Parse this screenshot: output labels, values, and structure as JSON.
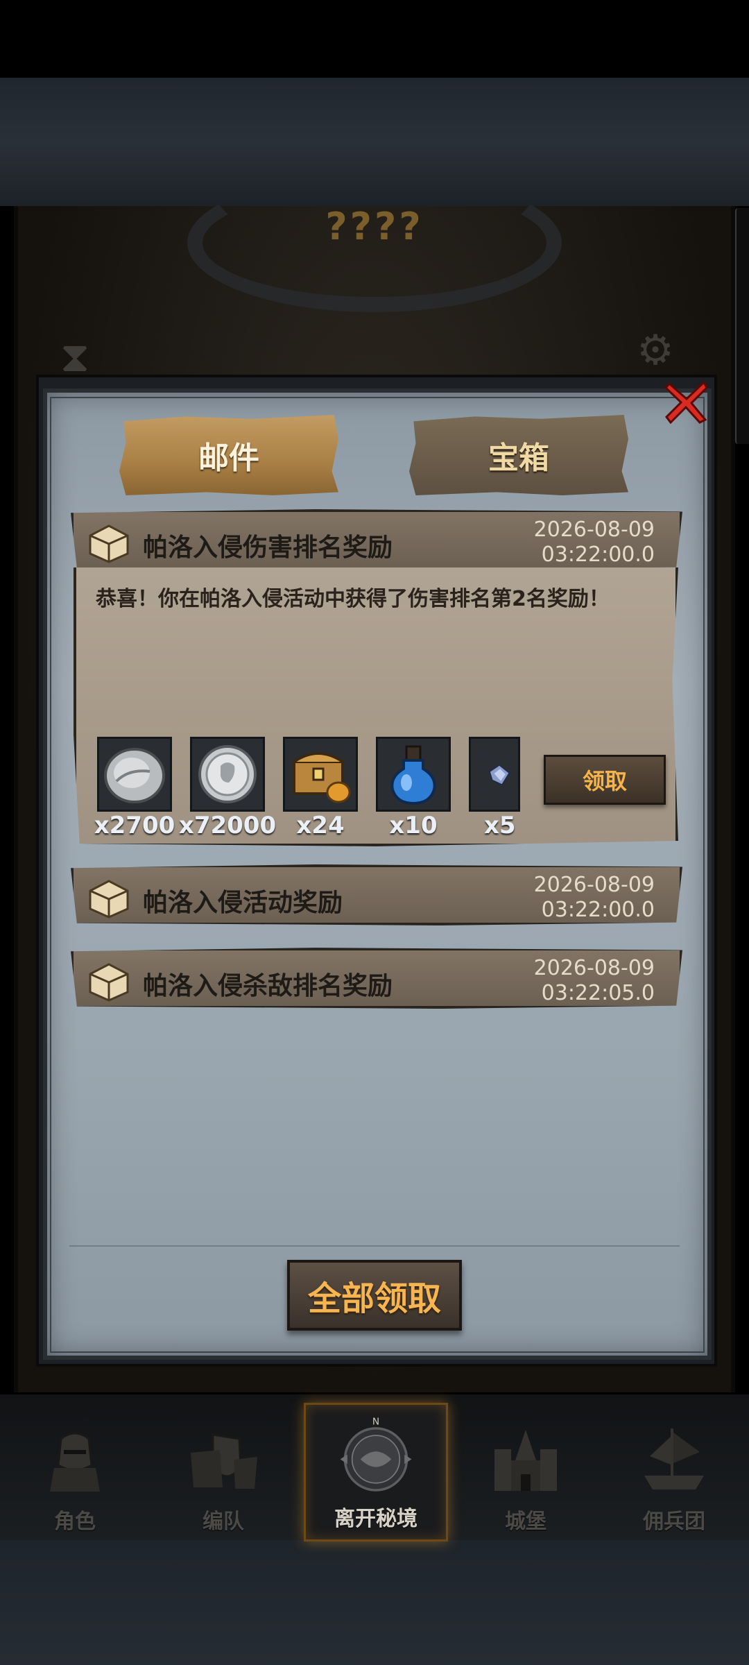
{
  "map": {
    "title": "????"
  },
  "tabs": [
    {
      "label": "邮件",
      "active": true
    },
    {
      "label": "宝箱",
      "active": false
    }
  ],
  "mails": [
    {
      "title": "帕洛入侵伤害排名奖励",
      "date": "2026-08-09",
      "time": "03:22:00.0",
      "expanded": true,
      "message": "恭喜！你在帕洛入侵活动中获得了伤害排名第2名奖励！",
      "rewards": [
        {
          "icon": "silver-ore-icon",
          "qty": "x2700"
        },
        {
          "icon": "silver-coin-icon",
          "qty": "x72000"
        },
        {
          "icon": "treasure-chest-icon",
          "qty": "x24"
        },
        {
          "icon": "blue-potion-icon",
          "qty": "x10"
        },
        {
          "icon": "crystal-shard-icon",
          "qty": "x5"
        }
      ],
      "claim_label": "领取"
    },
    {
      "title": "帕洛入侵活动奖励",
      "date": "2026-08-09",
      "time": "03:22:00.0",
      "expanded": false
    },
    {
      "title": "帕洛入侵杀敌排名奖励",
      "date": "2026-08-09",
      "time": "03:22:05.0",
      "expanded": false
    }
  ],
  "claim_all_label": "全部领取",
  "nav": [
    {
      "label": "角色",
      "icon": "knight-helmet-icon"
    },
    {
      "label": "编队",
      "icon": "formation-shield-icon"
    },
    {
      "label": "离开秘境",
      "icon": "compass-icon",
      "active": true
    },
    {
      "label": "城堡",
      "icon": "castle-icon"
    },
    {
      "label": "佣兵团",
      "icon": "mercenary-ship-icon"
    }
  ],
  "colors": {
    "accent": "#f7b552",
    "close": "#d92b22",
    "modal_bg": "#9aa6af",
    "card": "#a89b8a"
  }
}
